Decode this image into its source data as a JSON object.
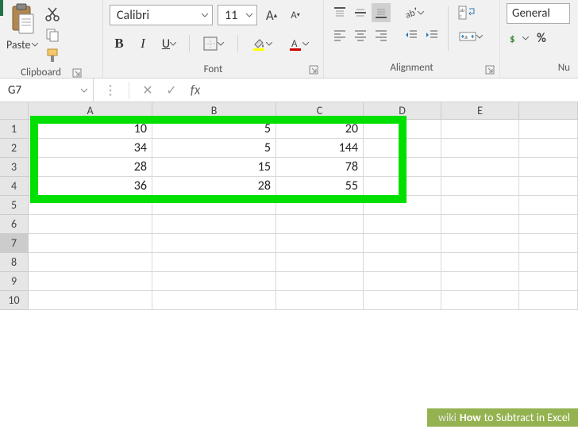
{
  "ribbon": {
    "clipboard": {
      "paste_label": "Paste",
      "group_label": "Clipboard"
    },
    "font": {
      "name": "Calibri",
      "size": "11",
      "group_label": "Font"
    },
    "alignment": {
      "group_label": "Alignment"
    },
    "number": {
      "format": "General",
      "group_label": "Nu"
    }
  },
  "formula_bar": {
    "name_box": "G7",
    "fx_label": "fx"
  },
  "grid": {
    "columns": [
      "A",
      "B",
      "C",
      "D",
      "E",
      ""
    ],
    "rows": [
      "1",
      "2",
      "3",
      "4",
      "5",
      "6",
      "7",
      "8",
      "9",
      "10"
    ],
    "data": [
      [
        "10",
        "5",
        "20",
        "",
        "",
        ""
      ],
      [
        "34",
        "5",
        "144",
        "",
        "",
        ""
      ],
      [
        "28",
        "15",
        "78",
        "",
        "",
        ""
      ],
      [
        "36",
        "28",
        "55",
        "",
        "",
        ""
      ],
      [
        "",
        "",
        "",
        "",
        "",
        ""
      ],
      [
        "",
        "",
        "",
        "",
        "",
        ""
      ],
      [
        "",
        "",
        "",
        "",
        "",
        ""
      ],
      [
        "",
        "",
        "",
        "",
        "",
        ""
      ],
      [
        "",
        "",
        "",
        "",
        "",
        ""
      ],
      [
        "",
        "",
        "",
        "",
        "",
        ""
      ]
    ],
    "selected_row": 7
  },
  "watermark": {
    "prefix": "wiki",
    "brand": "How",
    "title": " to Subtract in Excel"
  }
}
